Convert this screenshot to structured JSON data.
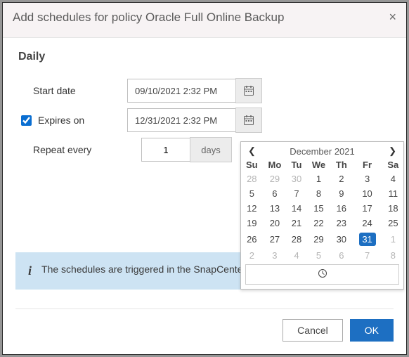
{
  "titlebar": {
    "title": "Add schedules for policy Oracle Full Online Backup"
  },
  "section": {
    "heading": "Daily"
  },
  "fields": {
    "startDateLabel": "Start date",
    "startDateValue": "09/10/2021 2:32 PM",
    "expiresLabel": "Expires on",
    "expiresChecked": true,
    "expiresValue": "12/31/2021 2:32 PM",
    "repeatLabel": "Repeat every",
    "repeatValue": "1",
    "repeatUnit": "days"
  },
  "calendar": {
    "monthLabel": "December 2021",
    "dow": [
      "Su",
      "Mo",
      "Tu",
      "We",
      "Th",
      "Fr",
      "Sa"
    ],
    "weeks": [
      [
        {
          "n": 28,
          "m": true
        },
        {
          "n": 29,
          "m": true
        },
        {
          "n": 30,
          "m": true
        },
        {
          "n": 1
        },
        {
          "n": 2
        },
        {
          "n": 3
        },
        {
          "n": 4
        }
      ],
      [
        {
          "n": 5
        },
        {
          "n": 6
        },
        {
          "n": 7
        },
        {
          "n": 8
        },
        {
          "n": 9
        },
        {
          "n": 10
        },
        {
          "n": 11
        }
      ],
      [
        {
          "n": 12
        },
        {
          "n": 13
        },
        {
          "n": 14
        },
        {
          "n": 15
        },
        {
          "n": 16
        },
        {
          "n": 17
        },
        {
          "n": 18
        }
      ],
      [
        {
          "n": 19
        },
        {
          "n": 20
        },
        {
          "n": 21
        },
        {
          "n": 22
        },
        {
          "n": 23
        },
        {
          "n": 24
        },
        {
          "n": 25
        }
      ],
      [
        {
          "n": 26
        },
        {
          "n": 27
        },
        {
          "n": 28
        },
        {
          "n": 29
        },
        {
          "n": 30
        },
        {
          "n": 31,
          "sel": true
        },
        {
          "n": 1,
          "m": true
        }
      ],
      [
        {
          "n": 2,
          "m": true
        },
        {
          "n": 3,
          "m": true
        },
        {
          "n": 4,
          "m": true
        },
        {
          "n": 5,
          "m": true
        },
        {
          "n": 6,
          "m": true
        },
        {
          "n": 7,
          "m": true
        },
        {
          "n": 8,
          "m": true
        }
      ]
    ]
  },
  "info": {
    "text": "The schedules are triggered in the SnapCenter Server time zone."
  },
  "buttons": {
    "cancel": "Cancel",
    "ok": "OK"
  }
}
